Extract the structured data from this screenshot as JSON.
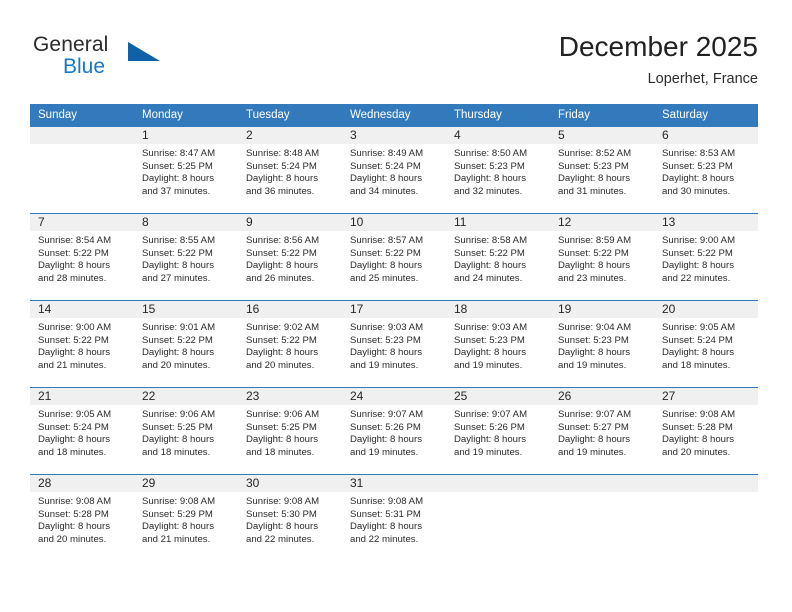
{
  "brand": {
    "name_top": "General",
    "name_bottom": "Blue",
    "triangle_color": "#1161a8",
    "blue_text_color": "#1878c8"
  },
  "header": {
    "title": "December 2025",
    "subtitle": "Loperhet, France"
  },
  "theme": {
    "header_row_bg": "#337ABC",
    "header_row_text": "#ffffff",
    "daynum_band_bg": "#f0f0f0",
    "week_separator": "#337ABC"
  },
  "weekday_headers": [
    "Sunday",
    "Monday",
    "Tuesday",
    "Wednesday",
    "Thursday",
    "Friday",
    "Saturday"
  ],
  "weeks": [
    [
      {
        "day": "",
        "sunrise": "",
        "sunset": "",
        "daylight_line1": "",
        "daylight_line2": "",
        "empty": true
      },
      {
        "day": "1",
        "sunrise": "Sunrise: 8:47 AM",
        "sunset": "Sunset: 5:25 PM",
        "daylight_line1": "Daylight: 8 hours",
        "daylight_line2": "and 37 minutes."
      },
      {
        "day": "2",
        "sunrise": "Sunrise: 8:48 AM",
        "sunset": "Sunset: 5:24 PM",
        "daylight_line1": "Daylight: 8 hours",
        "daylight_line2": "and 36 minutes."
      },
      {
        "day": "3",
        "sunrise": "Sunrise: 8:49 AM",
        "sunset": "Sunset: 5:24 PM",
        "daylight_line1": "Daylight: 8 hours",
        "daylight_line2": "and 34 minutes."
      },
      {
        "day": "4",
        "sunrise": "Sunrise: 8:50 AM",
        "sunset": "Sunset: 5:23 PM",
        "daylight_line1": "Daylight: 8 hours",
        "daylight_line2": "and 32 minutes."
      },
      {
        "day": "5",
        "sunrise": "Sunrise: 8:52 AM",
        "sunset": "Sunset: 5:23 PM",
        "daylight_line1": "Daylight: 8 hours",
        "daylight_line2": "and 31 minutes."
      },
      {
        "day": "6",
        "sunrise": "Sunrise: 8:53 AM",
        "sunset": "Sunset: 5:23 PM",
        "daylight_line1": "Daylight: 8 hours",
        "daylight_line2": "and 30 minutes."
      }
    ],
    [
      {
        "day": "7",
        "sunrise": "Sunrise: 8:54 AM",
        "sunset": "Sunset: 5:22 PM",
        "daylight_line1": "Daylight: 8 hours",
        "daylight_line2": "and 28 minutes."
      },
      {
        "day": "8",
        "sunrise": "Sunrise: 8:55 AM",
        "sunset": "Sunset: 5:22 PM",
        "daylight_line1": "Daylight: 8 hours",
        "daylight_line2": "and 27 minutes."
      },
      {
        "day": "9",
        "sunrise": "Sunrise: 8:56 AM",
        "sunset": "Sunset: 5:22 PM",
        "daylight_line1": "Daylight: 8 hours",
        "daylight_line2": "and 26 minutes."
      },
      {
        "day": "10",
        "sunrise": "Sunrise: 8:57 AM",
        "sunset": "Sunset: 5:22 PM",
        "daylight_line1": "Daylight: 8 hours",
        "daylight_line2": "and 25 minutes."
      },
      {
        "day": "11",
        "sunrise": "Sunrise: 8:58 AM",
        "sunset": "Sunset: 5:22 PM",
        "daylight_line1": "Daylight: 8 hours",
        "daylight_line2": "and 24 minutes."
      },
      {
        "day": "12",
        "sunrise": "Sunrise: 8:59 AM",
        "sunset": "Sunset: 5:22 PM",
        "daylight_line1": "Daylight: 8 hours",
        "daylight_line2": "and 23 minutes."
      },
      {
        "day": "13",
        "sunrise": "Sunrise: 9:00 AM",
        "sunset": "Sunset: 5:22 PM",
        "daylight_line1": "Daylight: 8 hours",
        "daylight_line2": "and 22 minutes."
      }
    ],
    [
      {
        "day": "14",
        "sunrise": "Sunrise: 9:00 AM",
        "sunset": "Sunset: 5:22 PM",
        "daylight_line1": "Daylight: 8 hours",
        "daylight_line2": "and 21 minutes."
      },
      {
        "day": "15",
        "sunrise": "Sunrise: 9:01 AM",
        "sunset": "Sunset: 5:22 PM",
        "daylight_line1": "Daylight: 8 hours",
        "daylight_line2": "and 20 minutes."
      },
      {
        "day": "16",
        "sunrise": "Sunrise: 9:02 AM",
        "sunset": "Sunset: 5:22 PM",
        "daylight_line1": "Daylight: 8 hours",
        "daylight_line2": "and 20 minutes."
      },
      {
        "day": "17",
        "sunrise": "Sunrise: 9:03 AM",
        "sunset": "Sunset: 5:23 PM",
        "daylight_line1": "Daylight: 8 hours",
        "daylight_line2": "and 19 minutes."
      },
      {
        "day": "18",
        "sunrise": "Sunrise: 9:03 AM",
        "sunset": "Sunset: 5:23 PM",
        "daylight_line1": "Daylight: 8 hours",
        "daylight_line2": "and 19 minutes."
      },
      {
        "day": "19",
        "sunrise": "Sunrise: 9:04 AM",
        "sunset": "Sunset: 5:23 PM",
        "daylight_line1": "Daylight: 8 hours",
        "daylight_line2": "and 19 minutes."
      },
      {
        "day": "20",
        "sunrise": "Sunrise: 9:05 AM",
        "sunset": "Sunset: 5:24 PM",
        "daylight_line1": "Daylight: 8 hours",
        "daylight_line2": "and 18 minutes."
      }
    ],
    [
      {
        "day": "21",
        "sunrise": "Sunrise: 9:05 AM",
        "sunset": "Sunset: 5:24 PM",
        "daylight_line1": "Daylight: 8 hours",
        "daylight_line2": "and 18 minutes."
      },
      {
        "day": "22",
        "sunrise": "Sunrise: 9:06 AM",
        "sunset": "Sunset: 5:25 PM",
        "daylight_line1": "Daylight: 8 hours",
        "daylight_line2": "and 18 minutes."
      },
      {
        "day": "23",
        "sunrise": "Sunrise: 9:06 AM",
        "sunset": "Sunset: 5:25 PM",
        "daylight_line1": "Daylight: 8 hours",
        "daylight_line2": "and 18 minutes."
      },
      {
        "day": "24",
        "sunrise": "Sunrise: 9:07 AM",
        "sunset": "Sunset: 5:26 PM",
        "daylight_line1": "Daylight: 8 hours",
        "daylight_line2": "and 19 minutes."
      },
      {
        "day": "25",
        "sunrise": "Sunrise: 9:07 AM",
        "sunset": "Sunset: 5:26 PM",
        "daylight_line1": "Daylight: 8 hours",
        "daylight_line2": "and 19 minutes."
      },
      {
        "day": "26",
        "sunrise": "Sunrise: 9:07 AM",
        "sunset": "Sunset: 5:27 PM",
        "daylight_line1": "Daylight: 8 hours",
        "daylight_line2": "and 19 minutes."
      },
      {
        "day": "27",
        "sunrise": "Sunrise: 9:08 AM",
        "sunset": "Sunset: 5:28 PM",
        "daylight_line1": "Daylight: 8 hours",
        "daylight_line2": "and 20 minutes."
      }
    ],
    [
      {
        "day": "28",
        "sunrise": "Sunrise: 9:08 AM",
        "sunset": "Sunset: 5:28 PM",
        "daylight_line1": "Daylight: 8 hours",
        "daylight_line2": "and 20 minutes."
      },
      {
        "day": "29",
        "sunrise": "Sunrise: 9:08 AM",
        "sunset": "Sunset: 5:29 PM",
        "daylight_line1": "Daylight: 8 hours",
        "daylight_line2": "and 21 minutes."
      },
      {
        "day": "30",
        "sunrise": "Sunrise: 9:08 AM",
        "sunset": "Sunset: 5:30 PM",
        "daylight_line1": "Daylight: 8 hours",
        "daylight_line2": "and 22 minutes."
      },
      {
        "day": "31",
        "sunrise": "Sunrise: 9:08 AM",
        "sunset": "Sunset: 5:31 PM",
        "daylight_line1": "Daylight: 8 hours",
        "daylight_line2": "and 22 minutes."
      },
      {
        "day": "",
        "sunrise": "",
        "sunset": "",
        "daylight_line1": "",
        "daylight_line2": "",
        "empty": true
      },
      {
        "day": "",
        "sunrise": "",
        "sunset": "",
        "daylight_line1": "",
        "daylight_line2": "",
        "empty": true
      },
      {
        "day": "",
        "sunrise": "",
        "sunset": "",
        "daylight_line1": "",
        "daylight_line2": "",
        "empty": true
      }
    ]
  ]
}
